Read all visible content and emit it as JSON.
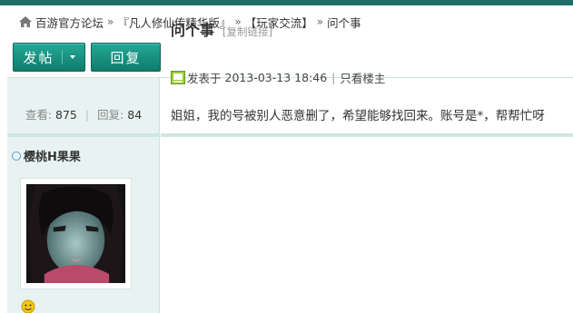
{
  "breadcrumb": {
    "items": [
      "百游官方论坛",
      "『凡人修仙传精华版』",
      "【玩家交流】",
      "问个事"
    ],
    "separator": "»"
  },
  "toolbar": {
    "post_label": "发帖",
    "reply_label": "回复"
  },
  "thread": {
    "views_label": "查看:",
    "views": "875",
    "replies_label": "回复:",
    "replies": "84",
    "title": "问个事",
    "copy_link_label": "[复制链接]"
  },
  "post": {
    "author": "樱桃H果果",
    "posted_prefix": "发表于",
    "posted_time": "2013-03-13 18:46",
    "only_author_label": "只看楼主",
    "body": "姐姐，我的号被别人恶意删了，希望能够找回来。账号是*，帮帮忙呀"
  },
  "colors": {
    "accent": "#179484",
    "sidebar_bg": "#e8f3f1",
    "status_dot": "#5a9bd1"
  },
  "icons": [
    "home-icon",
    "caret-down-icon",
    "online-status-icon",
    "post-icon",
    "smiley-icon"
  ]
}
